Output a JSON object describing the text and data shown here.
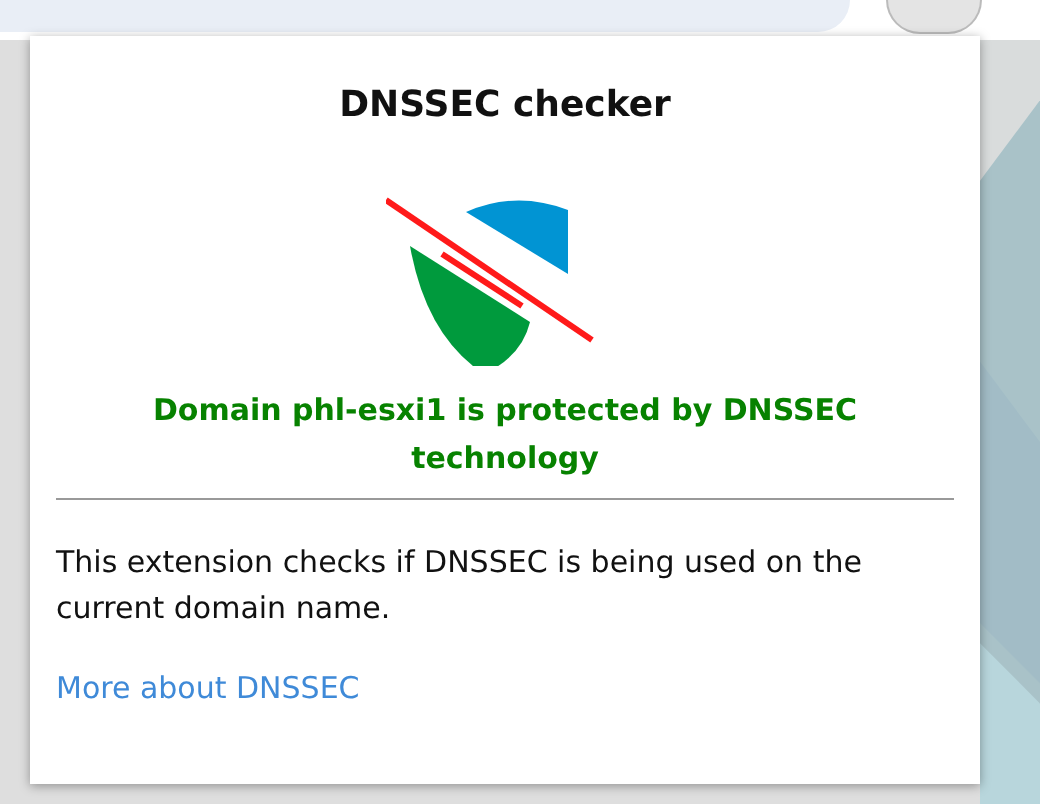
{
  "popup": {
    "title": "DNSSEC checker",
    "status": {
      "protected": true,
      "message": "Domain phl-esxi1 is protected by DNSSEC technology"
    },
    "description": "This extension checks if DNSSEC is being used on the current domain name.",
    "link": "More about DNSSEC"
  }
}
